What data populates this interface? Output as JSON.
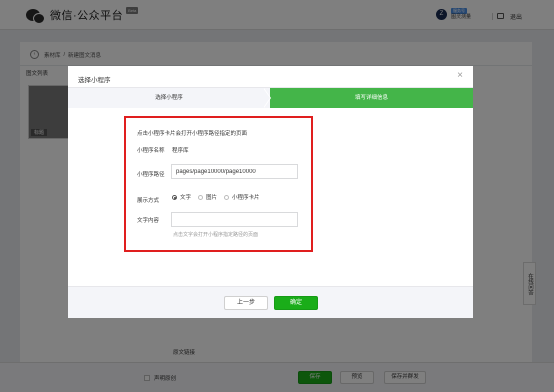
{
  "header": {
    "logo_text": "微信·公众平台",
    "logo_badge": "Beta",
    "account_tag": "服务号",
    "account_name": "图灵测量",
    "logout": "退出"
  },
  "page": {
    "back_icon": "‹",
    "breadcrumb": [
      "素材库",
      "/",
      "新建图文消息"
    ],
    "article_list_label": "图文列表",
    "cover_tag": "标题",
    "side_button": "在线问答",
    "original_link_label": "原文链接"
  },
  "bottom_bar": {
    "checkbox_label": "声明原创",
    "save": "保存",
    "preview": "预览",
    "publish": "保存并群发"
  },
  "dialog": {
    "title": "选择小程序",
    "close_icon": "×",
    "steps": [
      {
        "label": "选择小程序",
        "active": false
      },
      {
        "label": "填写详细信息",
        "active": true
      }
    ],
    "tip": "点击小程序卡片会打开小程序路径指定的页面",
    "name_label": "小程序名称",
    "name_value": "程序库",
    "path_label": "小程序路径",
    "path_value": "pages/page10000/page10000",
    "display_label": "展示方式",
    "display_options": [
      {
        "label": "文字",
        "checked": true
      },
      {
        "label": "图片",
        "checked": false
      },
      {
        "label": "小程序卡片",
        "checked": false
      }
    ],
    "text_label": "文字内容",
    "text_value": "",
    "text_hint": "点击文字会打开小程序指定路径的页面",
    "prev_button": "上一步",
    "ok_button": "确定"
  },
  "colors": {
    "accent_green": "#1aad19",
    "step_active": "#44b549",
    "highlight_red": "#e01e1e"
  }
}
